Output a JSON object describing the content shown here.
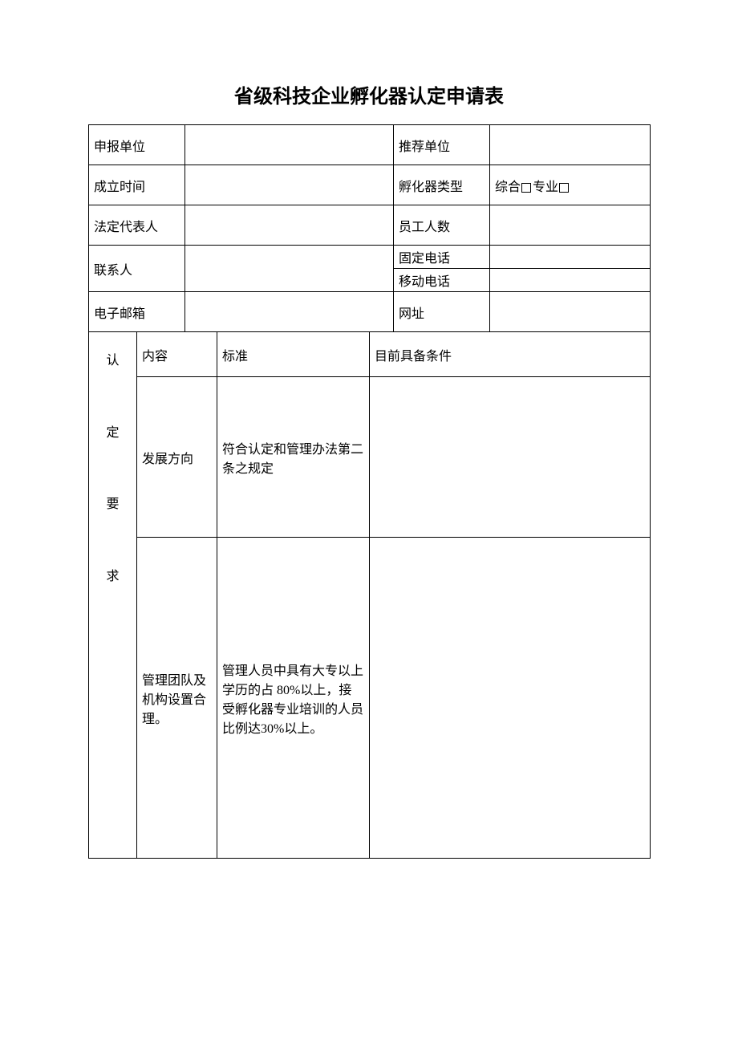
{
  "title": "省级科技企业孵化器认定申请表",
  "rows": {
    "declaring_unit_label": "申报单位",
    "declaring_unit_value": "",
    "recommend_unit_label": "推荐单位",
    "recommend_unit_value": "",
    "found_time_label": "成立时间",
    "found_time_value": "",
    "incubator_type_label": "孵化器类型",
    "incubator_type_opt1": "综合",
    "incubator_type_opt2": "专业",
    "legal_rep_label": "法定代表人",
    "legal_rep_value": "",
    "staff_count_label": "员工人数",
    "staff_count_value": "",
    "contact_label": "联系人",
    "contact_value": "",
    "phone_fixed_label": "固定电话",
    "phone_fixed_value": "",
    "phone_mobile_label": "移动电话",
    "phone_mobile_value": "",
    "email_label": "电子邮箱",
    "email_value": "",
    "website_label": "网址",
    "website_value": ""
  },
  "criteria": {
    "vertical_label_1": "认",
    "vertical_label_2": "定",
    "vertical_label_3": "要",
    "vertical_label_4": "求",
    "header_content": "内容",
    "header_standard": "标准",
    "header_current": "目前具备条件",
    "row1_content": "发展方向",
    "row1_standard": "符合认定和管理办法第二条之规定",
    "row1_current": "",
    "row2_content": "管理团队及机构设置合理。",
    "row2_standard": "管理人员中具有大专以上学历的占 80%以上，接受孵化器专业培训的人员比例达30%以上。",
    "row2_current": ""
  }
}
